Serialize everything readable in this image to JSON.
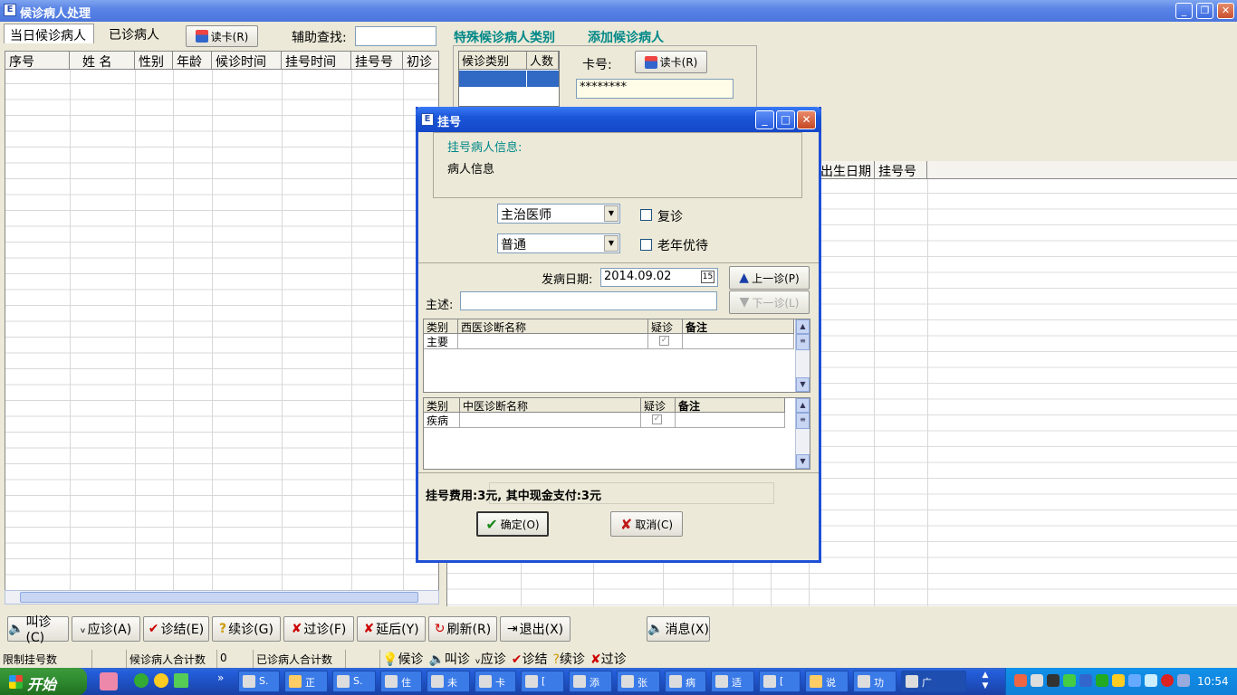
{
  "window": {
    "title": "候诊病人处理",
    "min": "_",
    "restore": "❐",
    "close": "✕"
  },
  "tabs": {
    "today": "当日候诊病人",
    "done": "已诊病人"
  },
  "toolbar": {
    "read_card": "读卡(R)",
    "search_label": "辅助查找:",
    "search_value": ""
  },
  "right_header": {
    "special": "特殊候诊病人类别",
    "add": "添加候诊病人"
  },
  "left_grid": {
    "columns": [
      "序号",
      "姓 名",
      "性别",
      "年龄",
      "候诊时间",
      "挂号时间",
      "挂号号",
      "初诊"
    ]
  },
  "category_grid": {
    "columns": [
      "候诊类别",
      "人数"
    ]
  },
  "card": {
    "label": "卡号:",
    "read_card": "读卡(R)",
    "value": "********"
  },
  "right_grid": {
    "columns": [
      "出生日期",
      "挂号号"
    ]
  },
  "dialog": {
    "title": "挂号",
    "info_title": "挂号病人信息:",
    "info_text": "病人信息",
    "doctor": "主治医师",
    "type": "普通",
    "revisit_label": "复诊",
    "elder_label": "老年优待",
    "onset_label": "发病日期:",
    "onset_value": "2014.09.02",
    "prev_btn": "上一诊(P)",
    "next_btn": "下一诊(L)",
    "complaint_label": "主述:",
    "western": {
      "headers": [
        "类别",
        "西医诊断名称",
        "疑诊",
        "备注"
      ],
      "row": [
        "主要",
        "",
        "",
        ""
      ]
    },
    "chinese": {
      "headers": [
        "类别",
        "中医诊断名称",
        "疑诊",
        "备注"
      ],
      "row": [
        "疾病",
        "",
        "",
        ""
      ]
    },
    "fee": "挂号费用:3元, 其中现金支付:3元",
    "ok": "确定(O)",
    "cancel": "取消(C)"
  },
  "actions": {
    "call": "叫诊(C)",
    "respond": "应诊(A)",
    "finish": "诊结(E)",
    "continue": "续诊(G)",
    "skip": "过诊(F)",
    "delay": "延后(Y)",
    "refresh": "刷新(R)",
    "exit": "退出(X)",
    "message": "消息(X)"
  },
  "status": {
    "limit": "限制挂号数",
    "waiting_total_label": "候诊病人合计数",
    "waiting_total": "0",
    "done_total_label": "已诊病人合计数",
    "legend": [
      "候诊",
      "叫诊",
      "应诊",
      "诊结",
      "续诊",
      "过诊"
    ]
  },
  "taskbar": {
    "start": "开始",
    "items": [
      "S.",
      "正",
      "S.",
      "住",
      "未",
      "卡",
      "[",
      "添",
      "张",
      "病",
      "适",
      "[",
      "说",
      "功",
      "广"
    ],
    "clock": "10:54"
  }
}
